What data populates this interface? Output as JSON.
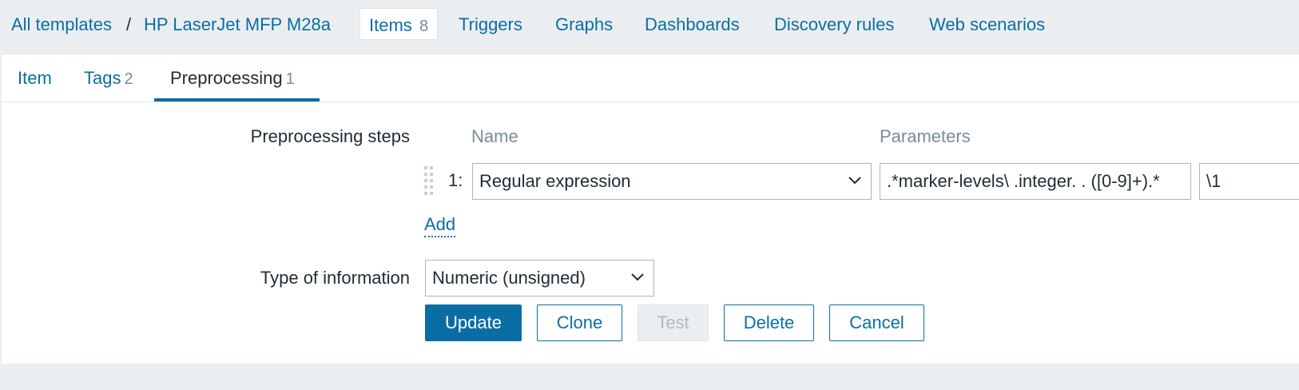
{
  "breadcrumb": {
    "all_templates": "All templates",
    "separator": "/",
    "template_name": "HP LaserJet MFP M28a"
  },
  "nav": {
    "items_label": "Items",
    "items_count": "8",
    "triggers": "Triggers",
    "graphs": "Graphs",
    "dashboards": "Dashboards",
    "discovery_rules": "Discovery rules",
    "web_scenarios": "Web scenarios"
  },
  "subtabs": {
    "item": "Item",
    "tags": "Tags",
    "tags_count": "2",
    "preprocessing": "Preprocessing",
    "preprocessing_count": "1"
  },
  "form": {
    "preprocessing_steps_label": "Preprocessing steps",
    "col_name": "Name",
    "col_parameters": "Parameters",
    "steps": [
      {
        "number": "1:",
        "name": "Regular expression",
        "param1": ".*marker-levels\\ .integer. . ([0-9]+).*",
        "param2": "\\1"
      }
    ],
    "add_label": "Add",
    "type_of_information_label": "Type of information",
    "type_of_information_value": "Numeric (unsigned)"
  },
  "buttons": {
    "update": "Update",
    "clone": "Clone",
    "test": "Test",
    "delete": "Delete",
    "cancel": "Cancel"
  },
  "colors": {
    "accent": "#0a6ea4",
    "muted": "#768d99",
    "background": "#ebeef0"
  },
  "icons": {
    "select_chevron": "chevron-down-icon",
    "drag_handle": "drag-handle-icon"
  }
}
